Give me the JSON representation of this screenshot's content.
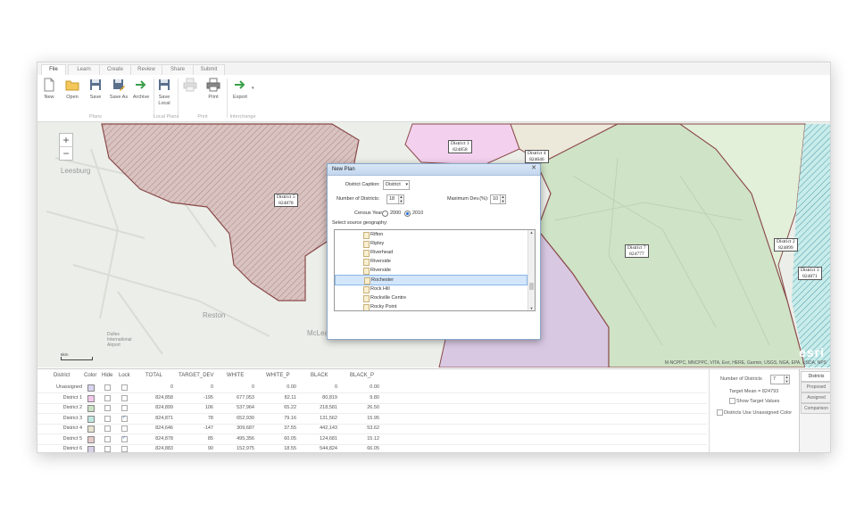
{
  "tabs": [
    "File",
    "Learn",
    "Create",
    "Review",
    "Share",
    "Submit"
  ],
  "ribbon": {
    "buttons": [
      {
        "label": "New",
        "icon": "new-document-icon"
      },
      {
        "label": "Open",
        "icon": "folder-open-icon"
      },
      {
        "label": "Save",
        "icon": "save-icon"
      },
      {
        "label": "Save As",
        "icon": "save-as-icon"
      },
      {
        "label": "Archive",
        "icon": "archive-arrow-icon"
      },
      {
        "label": "Save Local",
        "icon": "save-local-icon"
      },
      {
        "label": "Print",
        "icon": "printer-disabled-icon"
      },
      {
        "label": "Print",
        "icon": "printer-icon"
      },
      {
        "label": "Export",
        "icon": "export-arrow-icon"
      }
    ],
    "groups": [
      "Plans",
      "Local Plans",
      "Print",
      "Interchange"
    ]
  },
  "map": {
    "district_labels": [
      {
        "name": "District 5",
        "value": "824878"
      },
      {
        "name": "District 1",
        "value": "824858"
      },
      {
        "name": "District 4",
        "value": "824646"
      },
      {
        "name": "District 7",
        "value": "824777"
      },
      {
        "name": "District 2",
        "value": "824899"
      },
      {
        "name": "District 3",
        "value": "824871"
      }
    ],
    "places": [
      "Leesburg",
      "Reston",
      "McLean",
      "Dulles International Airport"
    ],
    "attribution": "M-NCPPC, MNCPPC, VITA, Esri, HERE, Garmin, USGS, NGA, EPA, USDA, NPS",
    "logo": "esri",
    "scale": "6km"
  },
  "dialog": {
    "title": "New Plan",
    "caption_label": "District Caption:",
    "caption_value": "District",
    "num_label": "Number of Districts:",
    "num_value": "18",
    "maxdev_label": "Maximum Dev.(%):",
    "maxdev_value": "10",
    "census_label": "Census Year:",
    "census_2000": "2000",
    "census_2010": "2010",
    "census_selected": "2010",
    "source_label": "Select source geography:",
    "items": [
      "Rifton",
      "Ripley",
      "Riverhead",
      "Riverside",
      "Riverside",
      "Rochester",
      "Rock Hill",
      "Rockville Centre",
      "Rocky Point"
    ],
    "selected_item": "Rochester"
  },
  "table": {
    "headers": [
      "District",
      "Color",
      "Hide",
      "Lock",
      "TOTAL",
      "TARGET_DEV",
      "WHITE",
      "WHITE_P",
      "BLACK",
      "BLACK_P"
    ],
    "rows": [
      {
        "district": "Unassigned",
        "color": "#d9d4f0",
        "hide": false,
        "lock": false,
        "total": "0",
        "target_dev": "0",
        "white": "0",
        "white_p": "0.00",
        "black": "0",
        "black_p": "0.00"
      },
      {
        "district": "District 1",
        "color": "#f4c6ea",
        "hide": false,
        "lock": false,
        "total": "824,858",
        "target_dev": "-195",
        "white": "677,053",
        "white_p": "82.11",
        "black": "80,819",
        "black_p": "9.80"
      },
      {
        "district": "District 2",
        "color": "#c9e2c3",
        "hide": false,
        "lock": false,
        "total": "824,899",
        "target_dev": "106",
        "white": "537,964",
        "white_p": "65.22",
        "black": "218,581",
        "black_p": "26.50"
      },
      {
        "district": "District 3",
        "color": "#bfe8e0",
        "hide": false,
        "lock": true,
        "total": "824,871",
        "target_dev": "78",
        "white": "652,930",
        "white_p": "79.16",
        "black": "131,562",
        "black_p": "15.95"
      },
      {
        "district": "District 4",
        "color": "#e7e2d0",
        "hide": false,
        "lock": false,
        "total": "824,646",
        "target_dev": "-147",
        "white": "309,687",
        "white_p": "37.55",
        "black": "442,143",
        "black_p": "53.62"
      },
      {
        "district": "District 5",
        "color": "#e6c9c9",
        "hide": false,
        "lock": true,
        "total": "824,878",
        "target_dev": "85",
        "white": "495,356",
        "white_p": "60.05",
        "black": "124,681",
        "black_p": "15.12"
      },
      {
        "district": "District 6",
        "color": "#d7cfe8",
        "hide": false,
        "lock": false,
        "total": "824,883",
        "target_dev": "90",
        "white": "152,975",
        "white_p": "18.55",
        "black": "544,824",
        "black_p": "66.05"
      }
    ]
  },
  "side_panel": {
    "num_label": "Number of Districts",
    "num_value": "7",
    "target_text": "Target Mean = 824793",
    "show_target": "Show Target Values",
    "unassigned_color": "Districts Use Unassigned Color"
  },
  "side_tabs": [
    "Districts",
    "Proposed",
    "Assigned",
    "Comparison"
  ]
}
